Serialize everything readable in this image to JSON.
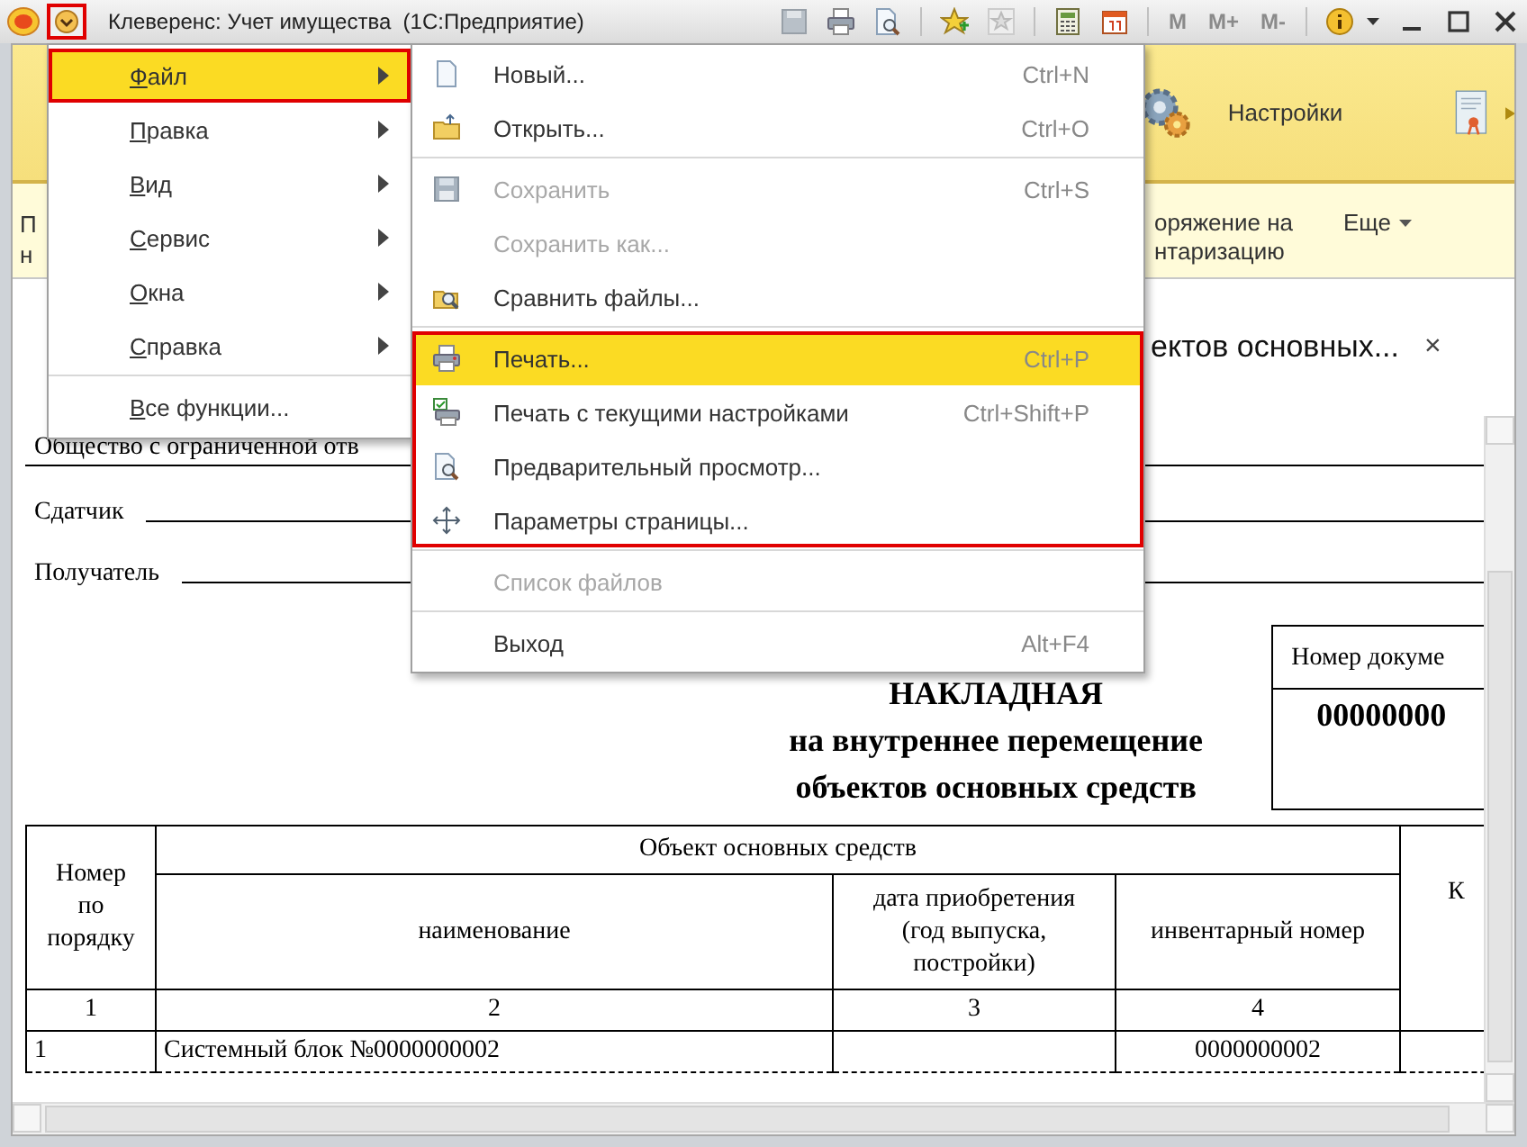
{
  "window": {
    "title": "Клеверенс: Учет имущества  (1С:Предприятие)",
    "menu_button": {
      "outlined": true
    },
    "memory_buttons": [
      {
        "label": "M",
        "disabled": true
      },
      {
        "label": "M+",
        "disabled": true
      },
      {
        "label": "M-",
        "disabled": true
      }
    ]
  },
  "section_panel": {
    "label": "Настройки"
  },
  "command_bar": {
    "left_fragment": [
      "П",
      "н"
    ],
    "command": [
      "оряжение на",
      "нтаризацию"
    ],
    "more": "Еще"
  },
  "document": {
    "title": "ектов основных...",
    "close": "×"
  },
  "report": {
    "organization": "Общество с ограниченной отв",
    "sender_label": "Сдатчик",
    "receiver_label": "Получатель",
    "doc_number_label": "Номер докуме",
    "doc_number": "00000000",
    "heading": [
      "НАКЛАДНАЯ",
      "на внутреннее перемещение",
      "объектов основных средств"
    ],
    "table": {
      "group_header": "Объект основных средств",
      "columns": [
        "Номер по порядку",
        "наименование",
        "дата приобретения (год выпуска, постройки)",
        "инвентарный номер",
        "К"
      ],
      "column_numbers": [
        "1",
        "2",
        "3",
        "4"
      ],
      "rows": [
        {
          "number": "1",
          "name": "Системный блок №0000000002",
          "inventory_number": "0000000002"
        }
      ]
    }
  },
  "main_menu": {
    "items": [
      {
        "kind": "submenu",
        "label": "Файл",
        "selected": true,
        "outlined": true
      },
      {
        "kind": "submenu",
        "label": "Правка",
        "selected": false,
        "outlined": false
      },
      {
        "kind": "submenu",
        "label": "Вид",
        "selected": false,
        "outlined": false
      },
      {
        "kind": "submenu",
        "label": "Сервис",
        "selected": false,
        "outlined": false
      },
      {
        "kind": "submenu",
        "label": "Окна",
        "selected": false,
        "outlined": false
      },
      {
        "kind": "submenu",
        "label": "Справка",
        "selected": false,
        "outlined": false
      },
      {
        "kind": "command",
        "label": "Все функции...",
        "selected": false,
        "outlined": false
      }
    ]
  },
  "file_menu": {
    "groups": [
      {
        "outlined": false,
        "items": [
          {
            "label": "Новый...",
            "shortcut": "Ctrl+N",
            "disabled": false,
            "selected": false
          },
          {
            "label": "Открыть...",
            "shortcut": "Ctrl+O",
            "disabled": false,
            "selected": false
          }
        ]
      },
      {
        "outlined": false,
        "items": [
          {
            "label": "Сохранить",
            "shortcut": "Ctrl+S",
            "disabled": true,
            "selected": false
          },
          {
            "label": "Сохранить как...",
            "disabled": true,
            "selected": false
          },
          {
            "label": "Сравнить файлы...",
            "disabled": false,
            "selected": false
          }
        ]
      },
      {
        "outlined": true,
        "items": [
          {
            "label": "Печать...",
            "shortcut": "Ctrl+P",
            "disabled": false,
            "selected": true
          },
          {
            "label": "Печать с текущими настройками",
            "shortcut": "Ctrl+Shift+P",
            "disabled": false,
            "selected": false
          },
          {
            "label": "Предварительный просмотр...",
            "disabled": false,
            "selected": false
          },
          {
            "label": "Параметры страницы...",
            "disabled": false,
            "selected": false
          }
        ]
      },
      {
        "outlined": false,
        "items": [
          {
            "label": "Список файлов",
            "disabled": true,
            "selected": false
          }
        ]
      },
      {
        "outlined": false,
        "items": [
          {
            "label": "Выход",
            "shortcut": "Alt+F4",
            "disabled": false,
            "selected": false
          }
        ]
      }
    ]
  }
}
